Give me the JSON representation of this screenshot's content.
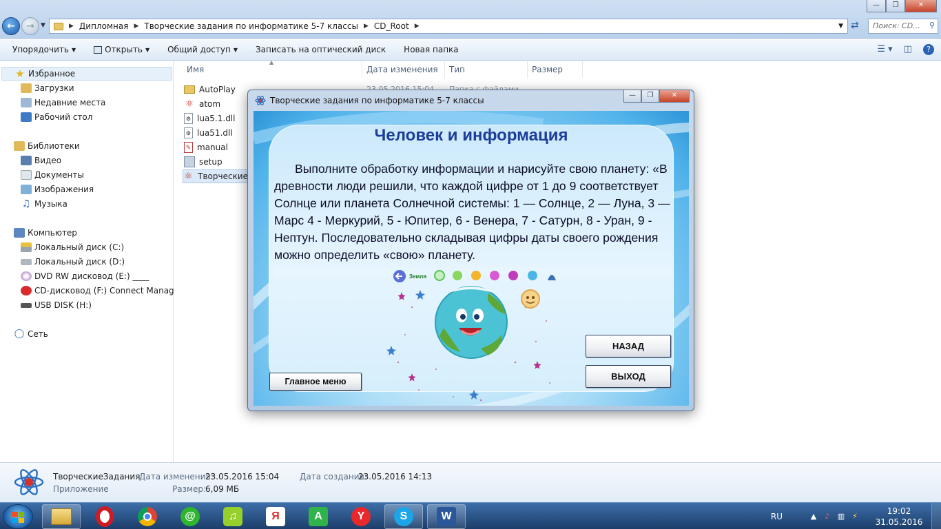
{
  "explorer": {
    "breadcrumb": [
      "Дипломная",
      "Творческие задания по информатике 5-7 классы",
      "CD_Root"
    ],
    "search_placeholder": "Поиск: CD...",
    "toolbar": {
      "organize": "Упорядочить",
      "open": "Открыть",
      "share": "Общий доступ",
      "burn": "Записать на оптический диск",
      "new_folder": "Новая папка"
    },
    "nav": {
      "favorites": "Избранное",
      "fav_items": [
        "Загрузки",
        "Недавние места",
        "Рабочий стол"
      ],
      "libraries": "Библиотеки",
      "lib_items": [
        "Видео",
        "Документы",
        "Изображения",
        "Музыка"
      ],
      "computer": "Компьютер",
      "comp_items": [
        "Локальный диск (C:)",
        "Локальный диск (D:)",
        "DVD RW дисковод (E:) ____",
        "CD-дисковод (F:) Connect Manager",
        "USB DISK (H:)"
      ],
      "network": "Сеть"
    },
    "columns": {
      "name": "Имя",
      "date": "Дата изменения",
      "type": "Тип",
      "size": "Размер"
    },
    "files": [
      "AutoPlay",
      "atom",
      "lua5.1.dll",
      "lua51.dll",
      "manual",
      "setup",
      "Творческие"
    ],
    "partial_row_date": "23.05.2016 15:04",
    "partial_row_type": "Папка с файлами",
    "details": {
      "name": "ТворческиеЗадания",
      "kind": "Приложение",
      "modified_label": "Дата изменения:",
      "modified_value": "23.05.2016 15:04",
      "size_label": "Размер:",
      "size_value": "6,09 МБ",
      "created_label": "Дата создания:",
      "created_value": "23.05.2016 14:13"
    }
  },
  "app": {
    "title": "Творческие задания по информатике 5-7 классы",
    "heading": "Человек и информация",
    "task_text": "Выполните обработку информации и нарисуйте свою планету: «В древности люди решили, что каждой цифре от 1 до 9 соответствует Солнце или планета Солнечной системы: 1 — Солнце, 2 — Луна, 3 — Марс 4 - Меркурий, 5 - Юпитер, 6 - Венера, 7 - Сатурн, 8 - Уран, 9 - Нептун. Последовательно складывая цифры даты своего рождения можно определить «свою» планету.",
    "strip_label": "Земля",
    "btn_back": "НАЗАД",
    "btn_exit": "ВЫХОД",
    "btn_main": "Главное меню"
  },
  "taskbar": {
    "lang": "RU",
    "time": "19:02",
    "date": "31.05.2016"
  },
  "colors": {
    "heading": "#1c3d9a",
    "accent_blue": "#2d94d6",
    "taskbar": "#1c3e6b"
  }
}
